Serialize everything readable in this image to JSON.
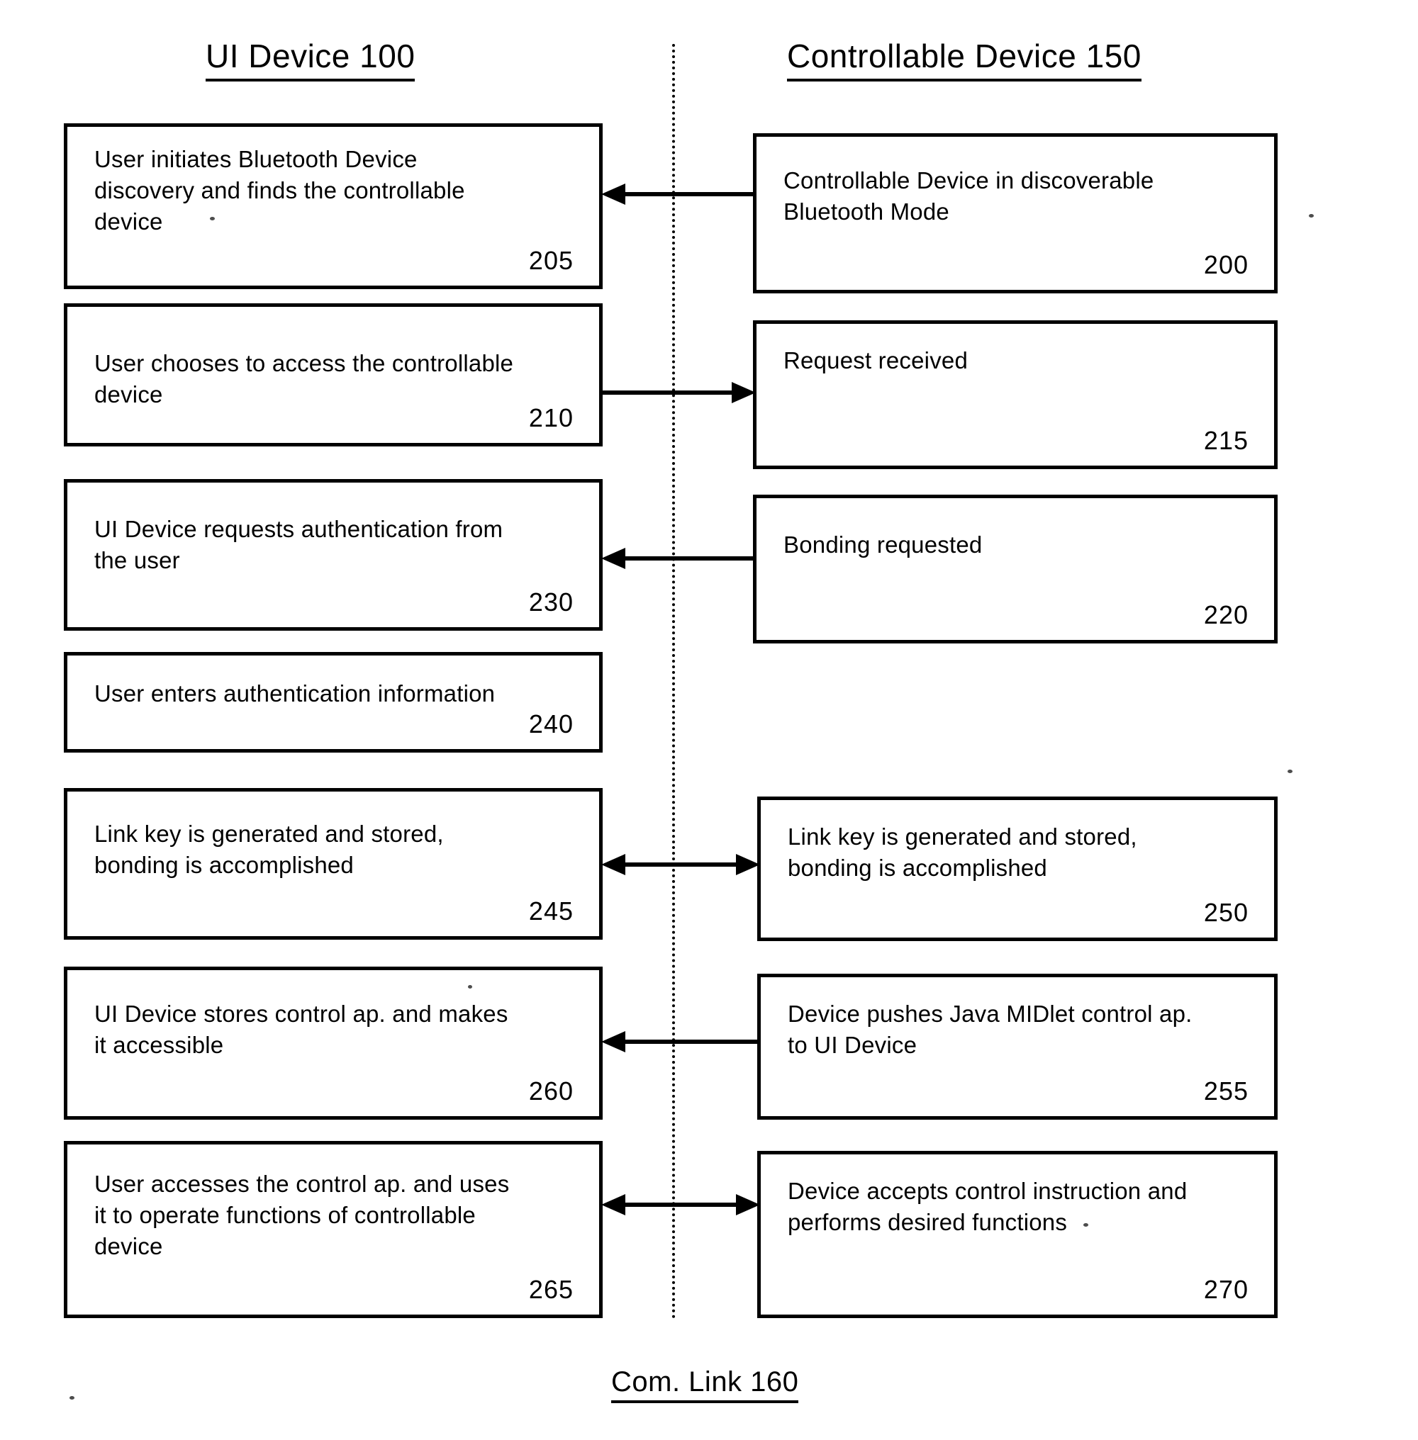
{
  "diagram": {
    "columns": {
      "left_title": "UI Device 100",
      "right_title": "Controllable Device 150"
    },
    "footer_label": "Com. Link 160",
    "left_boxes": [
      {
        "text": "User initiates Bluetooth Device\ndiscovery and finds the controllable\ndevice",
        "number": "205"
      },
      {
        "text": "User chooses to access the controllable\ndevice",
        "number": "210"
      },
      {
        "text": "UI Device requests authentication from\nthe user",
        "number": "230"
      },
      {
        "text": "User enters authentication information",
        "number": "240"
      },
      {
        "text": "Link key is generated and stored,\nbonding is accomplished",
        "number": "245"
      },
      {
        "text": "UI Device stores control ap. and makes\nit accessible",
        "number": "260"
      },
      {
        "text": "User accesses the control ap. and uses\nit to operate functions of controllable\ndevice",
        "number": "265"
      }
    ],
    "right_boxes": [
      {
        "text": "Controllable Device in discoverable\nBluetooth Mode",
        "number": "200"
      },
      {
        "text": "Request received",
        "number": "215"
      },
      {
        "text": "Bonding requested",
        "number": "220"
      },
      {
        "text": "Link key is generated and stored,\nbonding is accomplished",
        "number": "250"
      },
      {
        "text": "Device pushes Java MIDlet control ap.\nto UI Device",
        "number": "255"
      },
      {
        "text": "Device accepts control instruction and\nperforms desired functions",
        "number": "270"
      }
    ],
    "arrows": [
      {
        "direction": "left",
        "from": "200",
        "to": "205"
      },
      {
        "direction": "right",
        "from": "210",
        "to": "215"
      },
      {
        "direction": "left",
        "from": "220",
        "to": "230"
      },
      {
        "direction": "both",
        "from": "245",
        "to": "250"
      },
      {
        "direction": "left",
        "from": "255",
        "to": "260"
      },
      {
        "direction": "both",
        "from": "265",
        "to": "270"
      }
    ],
    "colors": {
      "ink": "#000000",
      "paper": "#ffffff"
    }
  }
}
